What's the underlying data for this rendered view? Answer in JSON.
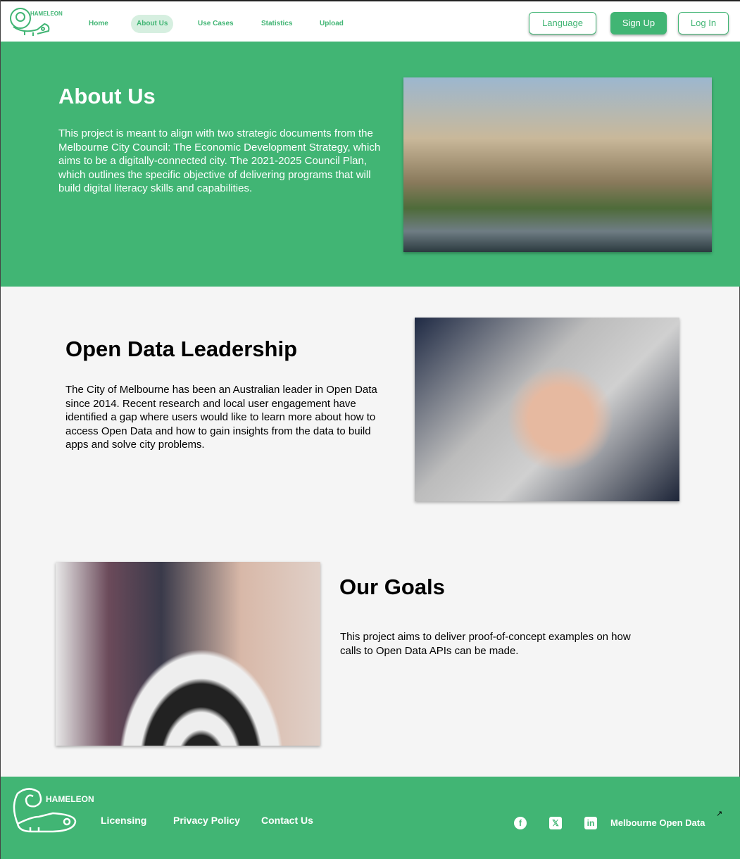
{
  "nav": {
    "brand": "HAMELEON",
    "links": [
      "Home",
      "About Us",
      "Use Cases",
      "Statistics",
      "Upload"
    ],
    "language": "Language",
    "signup": "Sign Up",
    "login": "Log In"
  },
  "about": {
    "title": "About Us",
    "text": "This project is meant to align with two strategic documents from the Melbourne City Council: The Economic Development Strategy, which aims to be a digitally-connected city. The 2021-2025 Council Plan, which outlines the specific objective of delivering programs that will build digital literacy skills and capabilities."
  },
  "leadership": {
    "title": "Open Data Leadership",
    "text": "The City of Melbourne has been an Australian leader in Open Data since 2014. Recent research and local user engagement have identified a gap where users would like to learn more about how to access Open Data and how to gain insights from the data to build apps and solve city problems."
  },
  "goals": {
    "title": "Our Goals",
    "text": "This project aims to deliver proof-of-concept examples on how calls to Open Data APIs can be made."
  },
  "footer": {
    "brand": "HAMELEON",
    "links": [
      "Licensing",
      "Privacy Policy",
      "Contact Us"
    ],
    "social": [
      "facebook-icon",
      "x-icon",
      "linkedin-icon"
    ],
    "external": "Melbourne Open Data"
  },
  "colors": {
    "accent": "#41b574"
  }
}
